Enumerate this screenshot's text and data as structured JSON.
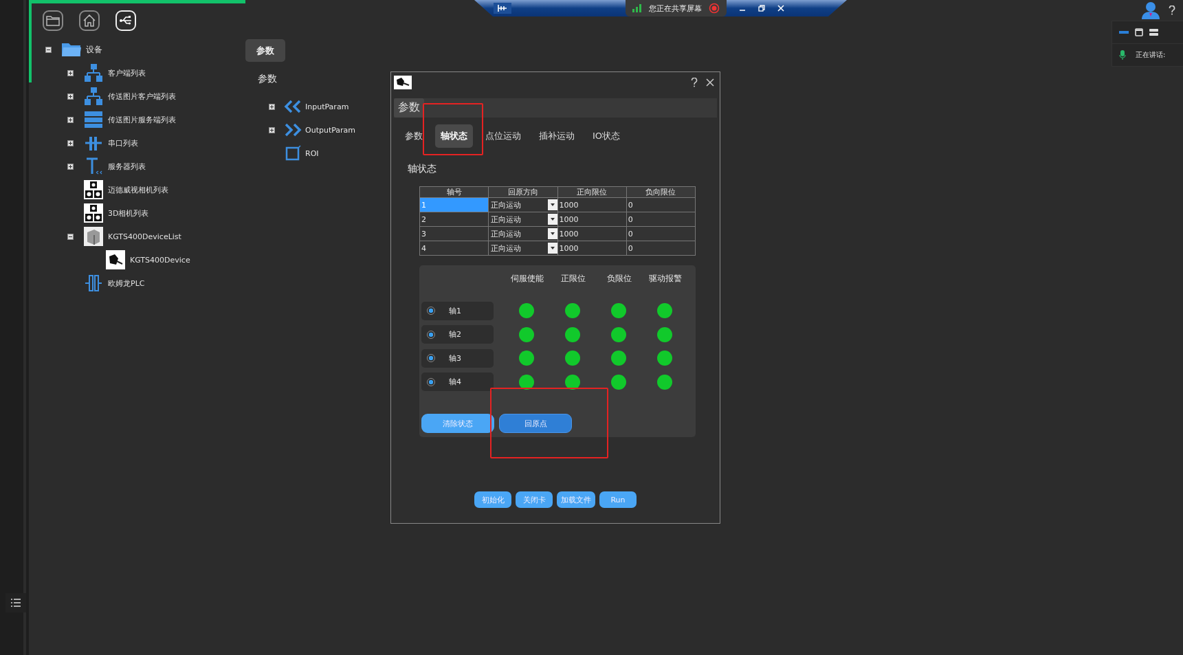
{
  "share_bar": {
    "status": "您正在共享屏幕"
  },
  "speaker_panel": {
    "label": "正在讲话:"
  },
  "device_tree": {
    "label": "设备",
    "kind": "folder",
    "expanded": true,
    "children": [
      {
        "label": "客户端列表",
        "kind": "network",
        "expanded": false
      },
      {
        "label": "传送图片客户端列表",
        "kind": "network",
        "expanded": false
      },
      {
        "label": "传送图片服务端列表",
        "kind": "server",
        "expanded": false
      },
      {
        "label": "串口列表",
        "kind": "serial",
        "expanded": false
      },
      {
        "label": "服务器列表",
        "kind": "tool",
        "expanded": false
      },
      {
        "label": "迈德威视相机列表",
        "kind": "camera"
      },
      {
        "label": "3D相机列表",
        "kind": "camera"
      },
      {
        "label": "KGTS400DeviceList",
        "kind": "device",
        "expanded": true,
        "children": [
          {
            "label": "KGTS400Device",
            "kind": "motor"
          }
        ]
      },
      {
        "label": "欧姆龙PLC",
        "kind": "plc"
      }
    ]
  },
  "param_button": "参数",
  "param_tree": {
    "label": "参数",
    "children": [
      {
        "label": "InputParam",
        "kind": "input",
        "expanded": false
      },
      {
        "label": "OutputParam",
        "kind": "output",
        "expanded": false
      },
      {
        "label": "ROI",
        "kind": "roi"
      }
    ]
  },
  "dialog": {
    "group": "参数",
    "tabs": [
      {
        "label": "参数",
        "selected": false
      },
      {
        "label": "轴状态",
        "selected": true
      },
      {
        "label": "点位运动",
        "selected": false
      },
      {
        "label": "插补运动",
        "selected": false
      },
      {
        "label": "IO状态",
        "selected": false
      }
    ],
    "section_title": "轴状态",
    "table": {
      "columns": [
        "轴号",
        "回原方向",
        "正向限位",
        "负向限位"
      ],
      "rows": [
        {
          "axis": "1",
          "direction": "正向运动",
          "pos_limit": "1000",
          "neg_limit": "0",
          "selected": true
        },
        {
          "axis": "2",
          "direction": "正向运动",
          "pos_limit": "1000",
          "neg_limit": "0",
          "selected": false
        },
        {
          "axis": "3",
          "direction": "正向运动",
          "pos_limit": "1000",
          "neg_limit": "0",
          "selected": false
        },
        {
          "axis": "4",
          "direction": "正向运动",
          "pos_limit": "1000",
          "neg_limit": "0",
          "selected": false
        }
      ]
    },
    "status": {
      "columns": [
        "伺服使能",
        "正限位",
        "负限位",
        "驱动报警"
      ],
      "axes": [
        {
          "label": "轴1",
          "checked": true,
          "lights": [
            true,
            true,
            true,
            true
          ]
        },
        {
          "label": "轴2",
          "checked": true,
          "lights": [
            true,
            true,
            true,
            true
          ]
        },
        {
          "label": "轴3",
          "checked": true,
          "lights": [
            true,
            true,
            true,
            true
          ]
        },
        {
          "label": "轴4",
          "checked": true,
          "lights": [
            true,
            true,
            true,
            true
          ]
        }
      ],
      "buttons": [
        "清除状态",
        "回原点"
      ]
    },
    "footer_buttons": [
      "初始化",
      "关闭卡",
      "加载文件",
      "Run"
    ]
  }
}
